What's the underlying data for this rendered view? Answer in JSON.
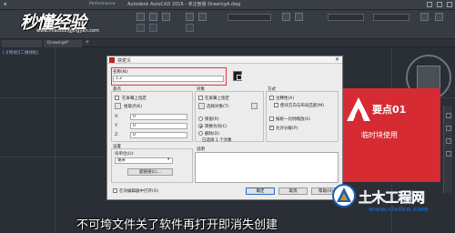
{
  "app": {
    "title": "Autodesk AutoCAD 2016 - 未注册版    Drawing4.dwg",
    "quick_tab": "Performance",
    "drawing_tab": "Drawing4*",
    "new_tab": "+",
    "viewport_label": "[-][俯视][二维线框]"
  },
  "overlay": {
    "logo_text": "秒懂经验",
    "logo_url": "www.miaodongjingyan.com",
    "note_title": "要点01",
    "note_body": "临时块使用",
    "subtitle": "不可垮文件关了软件再打开即消失创建",
    "watermark_title": "土木工程网",
    "watermark_url": "www.civilcn.com",
    "accent_color": "#d62b32",
    "watermark_color": "#1b5fae"
  },
  "dialog": {
    "title": "块定义",
    "name_label": "名称(N):",
    "name_value": "1.2",
    "base": {
      "header": "基点",
      "on_screen": "在屏幕上指定",
      "pick_point": "拾取点(K)",
      "x_label": "X:",
      "y_label": "Y:",
      "z_label": "Z:",
      "x": "0",
      "y": "0",
      "z": "0"
    },
    "objects": {
      "header": "对象",
      "on_screen": "在屏幕上指定",
      "select": "选择对象(T)",
      "retain": "保留(R)",
      "convert": "转换为块(C)",
      "delete": "删除(D)",
      "status": "已选择 1 个对象"
    },
    "behavior": {
      "header": "方式",
      "annotative": "注释性(A)",
      "match": "使块方向与布局匹配(M)",
      "scale_uniform": "按统一比例缩放(S)",
      "allow_explode": "允许分解(P)"
    },
    "settings": {
      "header": "设置",
      "unit_label": "块单位(U):",
      "unit_value": "毫米",
      "hyperlink": "超链接(L)..."
    },
    "description_label": "说明",
    "open_in_editor": "在块编辑器中打开(O)",
    "ok": "确定",
    "cancel": "取消",
    "help": "帮助(H)"
  }
}
